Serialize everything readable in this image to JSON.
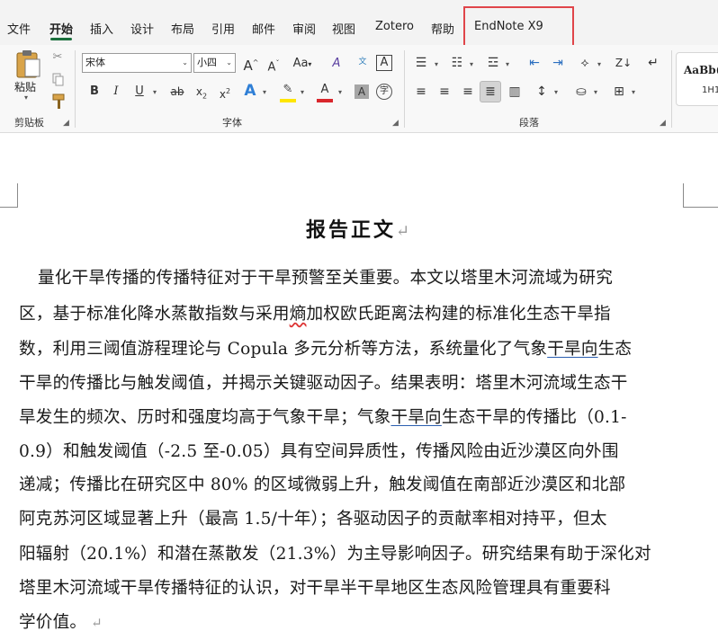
{
  "tabs": [
    "文件",
    "开始",
    "插入",
    "设计",
    "布局",
    "引用",
    "邮件",
    "审阅",
    "视图",
    "Zotero",
    "帮助",
    "EndNote X9"
  ],
  "active_tab": "开始",
  "ribbon": {
    "clipboard": {
      "paste_label": "粘贴",
      "group_label": "剪贴板"
    },
    "font": {
      "font_name": "宋体",
      "font_size": "小四",
      "group_label": "字体",
      "case_label": "Aa",
      "grow_label": "A",
      "shrink_label": "A"
    },
    "paragraph": {
      "group_label": "段落"
    },
    "styles": {
      "sample": "AaBb(",
      "name": "1H1"
    }
  },
  "document": {
    "title": "报告正文",
    "lines": [
      "量化干旱传播的传播特征对于干旱预警至关重要。本文以塔里木河流域为研究",
      [
        "区，基于标准化降水蒸散指数与采用",
        "熵",
        "加权欧氏距离法构建的标准化生态干旱指"
      ],
      [
        "数，利用三阈值游程理论与 Copula 多元分析等方法，系统量化了气象",
        "干旱向",
        "生态"
      ],
      "干旱的传播比与触发阈值，并揭示关键驱动因子。结果表明：塔里木河流域生态干",
      [
        "旱发生的频次、历时和强度均高于气象干旱；气象",
        "干旱向",
        "生态干旱的传播比（0.1-"
      ],
      "0.9）和触发阈值（-2.5 至-0.05）具有空间异质性，传播风险由近沙漠区向外围",
      "递减；传播比在研究区中 80%  的区域微弱上升，触发阈值在南部近沙漠区和北部",
      "阿克苏河区域显著上升（最高 1.5/十年）；各驱动因子的贡献率相对持平，但太",
      "阳辐射（20.1%）和潜在蒸散发（21.3%）为主导影响因子。研究结果有助于深化对",
      "塔里木河流域干旱传播特征的认识，对干旱半干旱地区生态风险管理具有重要科",
      "学价值。"
    ]
  }
}
